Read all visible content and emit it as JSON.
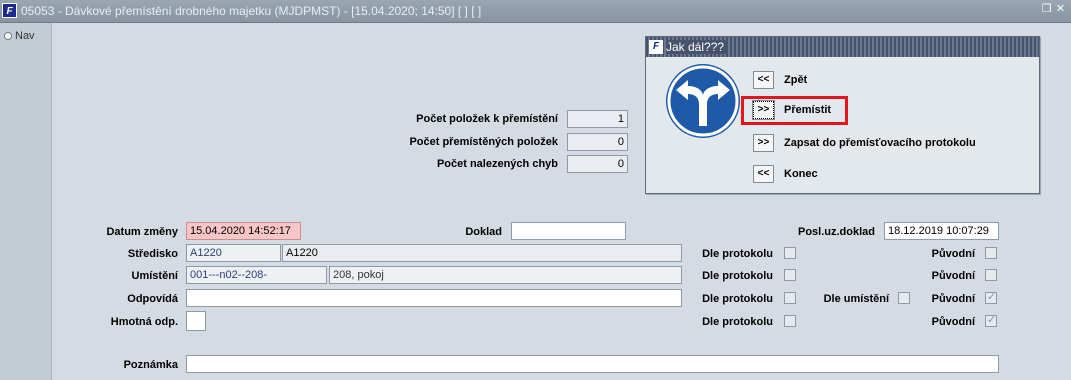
{
  "window": {
    "title": "05053 - Dávkové přemístění drobného majetku (MJDPMST) - [15.04.2020; 14:50]  [ ]  [ ]",
    "app_icon_text": "F"
  },
  "nav": {
    "label": "Nav"
  },
  "dialog": {
    "title": "Jak dál???",
    "icon_text": "F",
    "buttons": [
      {
        "symbol": "<<",
        "label": "Zpět"
      },
      {
        "symbol": ">>",
        "label": "Přemístit"
      },
      {
        "symbol": ">>",
        "label": "Zapsat do přemísťovacího protokolu"
      },
      {
        "symbol": "<<",
        "label": "Konec"
      }
    ],
    "sign_icon": "turn-left-right-sign-icon"
  },
  "summary": {
    "count_to_move_label": "Počet položek k přemístění",
    "count_to_move": "1",
    "count_moved_label": "Počet přemístěných položek",
    "count_moved": "0",
    "count_errors_label": "Počet nalezených chyb",
    "count_errors": "0"
  },
  "form": {
    "datum_label": "Datum změny",
    "datum_value": "15.04.2020 14:52:17",
    "doklad_label": "Doklad",
    "doklad_value": "",
    "posl_label": "Posl.uz.doklad",
    "posl_value": "18.12.2019 10:07:29",
    "stredisko_label": "Středisko",
    "stredisko_code": "A1220",
    "stredisko_name": "A1220",
    "umisteni_label": "Umístění",
    "umisteni_code": "001---n02--208-",
    "umisteni_name": "208, pokoj",
    "odpovida_label": "Odpovídá",
    "odpovida_value": "",
    "hmotna_label": "Hmotná odp.",
    "hmotna_value": "",
    "dle_protokolu_label": "Dle protokolu",
    "dle_umisteni_label": "Dle umístění",
    "puvodni_label": "Původní",
    "poznamka_label": "Poznámka",
    "poznamka_value": ""
  },
  "colors": {
    "highlight": "#e3161d",
    "sign_blue": "#1e5aa8",
    "error_field": "#f8c6c6"
  }
}
